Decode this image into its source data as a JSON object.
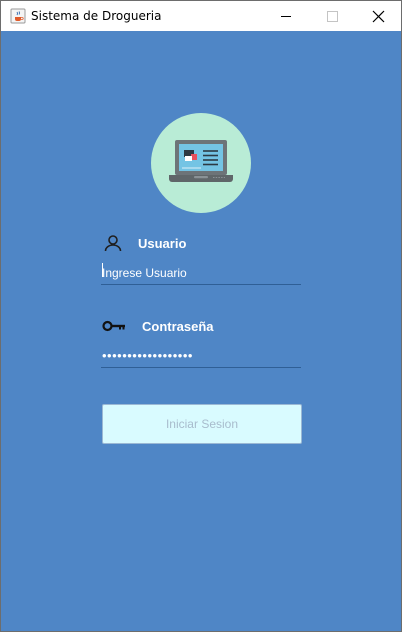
{
  "window": {
    "title": "Sistema de Drogueria",
    "icon": "java-cup-icon"
  },
  "logo": {
    "icon": "laptop-medical-icon",
    "circle_color": "#b9ecd6"
  },
  "form": {
    "username": {
      "label": "Usuario",
      "icon": "user-icon",
      "placeholder": "Ingrese Usuario",
      "value": ""
    },
    "password": {
      "label": "Contraseña",
      "icon": "key-icon",
      "value": "••••••••••••••••••"
    },
    "submit_label": "Iniciar Sesion"
  },
  "colors": {
    "background": "#4f86c6",
    "button_bg": "#d9fbff",
    "button_text": "#a8bccd"
  }
}
